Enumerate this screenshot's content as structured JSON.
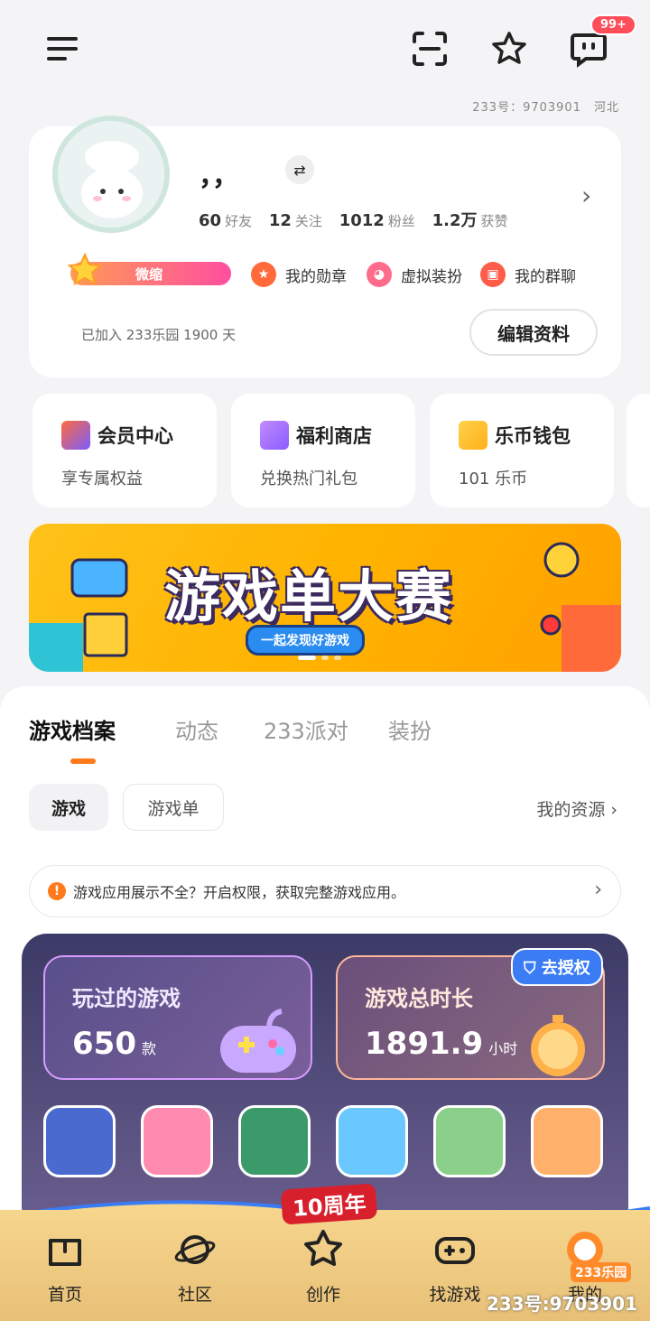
{
  "top": {
    "badge": "99+",
    "id_label": "233号：",
    "id_value": "9703901",
    "region": "河北"
  },
  "profile": {
    "nickname": "，，",
    "stats": [
      {
        "value": "60",
        "label": "好友"
      },
      {
        "value": "12",
        "label": "关注"
      },
      {
        "value": "1012",
        "label": "粉丝"
      },
      {
        "value": "1.2万",
        "label": "获赞"
      }
    ],
    "level_label": "微缩",
    "features": [
      "我的勋章",
      "虚拟装扮",
      "我的群聊"
    ],
    "joined": "已加入 233乐园 1900 天",
    "edit_label": "编辑资料"
  },
  "quick_cards": [
    {
      "title": "会员中心",
      "desc": "享专属权益"
    },
    {
      "title": "福利商店",
      "desc": "兑换热门礼包"
    },
    {
      "title": "乐币钱包",
      "desc": "101 乐币"
    }
  ],
  "banner": {
    "title": "游戏单大赛",
    "subtitle": "一起发现好游戏"
  },
  "tabs": [
    "游戏档案",
    "动态",
    "233派对",
    "装扮"
  ],
  "chips": [
    "游戏",
    "游戏单"
  ],
  "resources_link": "我的资源",
  "notice": "游戏应用展示不全？开启权限，获取完整游戏应用。",
  "game_stats": {
    "played_label": "玩过的游戏",
    "played_value": "650",
    "played_unit": "款",
    "time_label": "游戏总时长",
    "time_value": "1891.9",
    "time_unit": "小时",
    "auth_label": "去授权"
  },
  "anniversary": "10周年",
  "nav": [
    "首页",
    "社区",
    "创作",
    "找游戏",
    "我的"
  ],
  "nav_badge": "233乐园",
  "watermark": "233号:9703901",
  "colors": {
    "accent": "#ff7a1a",
    "banner": "#ffb300",
    "nav_bg": "#f0cc83"
  }
}
